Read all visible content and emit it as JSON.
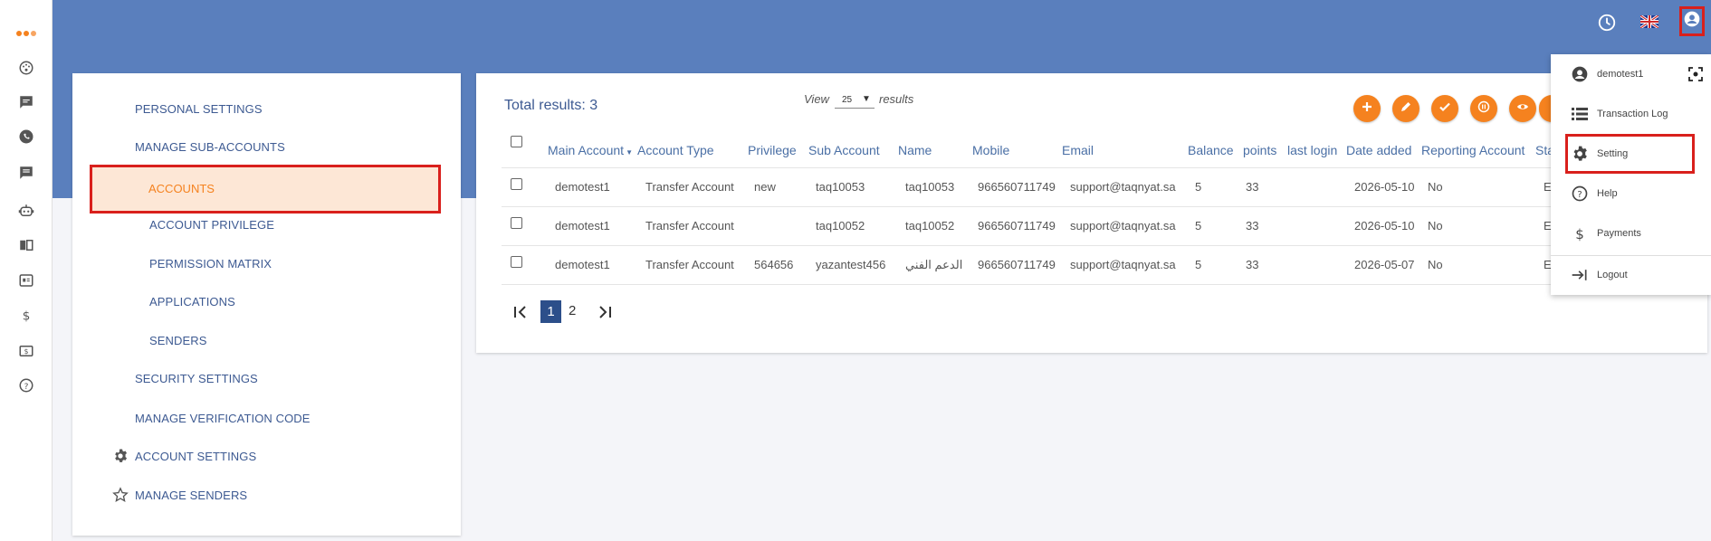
{
  "header": {
    "icons": [
      "clock-icon",
      "uk-flag-icon",
      "account-circle-icon"
    ]
  },
  "left_rail": {
    "icons": [
      "dots-icon",
      "dashboard-icon",
      "chat-icon",
      "whatsapp-icon",
      "message-icon",
      "bot-icon",
      "book-icon",
      "contacts-icon",
      "dollar-icon",
      "billing-icon",
      "help-icon"
    ]
  },
  "sidebar": {
    "items": [
      {
        "label": "PERSONAL SETTINGS"
      },
      {
        "label": "MANAGE SUB-ACCOUNTS"
      },
      {
        "label": "ACCOUNTS"
      },
      {
        "label": "ACCOUNT PRIVILEGE"
      },
      {
        "label": "PERMISSION MATRIX"
      },
      {
        "label": "APPLICATIONS"
      },
      {
        "label": "SENDERS"
      },
      {
        "label": "SECURITY SETTINGS"
      },
      {
        "label": "MANAGE VERIFICATION CODE"
      },
      {
        "label": "ACCOUNT SETTINGS"
      },
      {
        "label": "MANAGE SENDERS"
      }
    ],
    "active": "ACCOUNTS"
  },
  "main": {
    "total_results": "Total results: 3",
    "view_label": "View",
    "page_size": "25",
    "results_label": "results",
    "columns": [
      "Main Account",
      "Account Type",
      "Privilege",
      "Sub Account",
      "Name",
      "Mobile",
      "Email",
      "Balance",
      "points",
      "last login",
      "Date added",
      "Reporting Account",
      "Sta"
    ],
    "rows": [
      {
        "main_account": "demotest1",
        "account_type": "Transfer Account",
        "privilege": "new",
        "sub_account": "taq10053",
        "name": "taq10053",
        "mobile": "966560711749",
        "email": "support@taqnyat.sa",
        "balance": "5",
        "points": "33",
        "last_login": "",
        "date_added": "2026-05-10",
        "reporting": "No",
        "status": "E"
      },
      {
        "main_account": "demotest1",
        "account_type": "Transfer Account",
        "privilege": "",
        "sub_account": "taq10052",
        "name": "taq10052",
        "mobile": "966560711749",
        "email": "support@taqnyat.sa",
        "balance": "5",
        "points": "33",
        "last_login": "",
        "date_added": "2026-05-10",
        "reporting": "No",
        "status": "E"
      },
      {
        "main_account": "demotest1",
        "account_type": "Transfer Account",
        "privilege": "564656",
        "sub_account": "yazantest456",
        "name": "الدعم الفني",
        "mobile": "966560711749",
        "email": "support@taqnyat.sa",
        "balance": "5",
        "points": "33",
        "last_login": "",
        "date_added": "2026-05-07",
        "reporting": "No",
        "status": "E"
      }
    ],
    "pagination": {
      "first": "first-page-icon",
      "pages": [
        "1",
        "2"
      ],
      "current": "1",
      "last": "last-page-icon"
    },
    "actions": [
      "add-icon",
      "edit-icon",
      "check-icon",
      "pause-icon",
      "view-icon",
      "more-icon"
    ]
  },
  "user_menu": {
    "items": [
      {
        "label": "demotest1",
        "icon": "account-circle-icon"
      },
      {
        "label": "Transaction Log",
        "icon": "list-icon"
      },
      {
        "label": "Setting",
        "icon": "gear-icon"
      },
      {
        "label": "Help",
        "icon": "help-icon"
      },
      {
        "label": "Payments",
        "icon": "dollar-icon"
      },
      {
        "label": "Logout",
        "icon": "logout-icon"
      }
    ]
  },
  "colors": {
    "header": "#5a7fbd",
    "accent": "#f5821f",
    "highlight": "#d9201c",
    "active_bg": "#fde7d6",
    "link": "#3d5a92"
  }
}
